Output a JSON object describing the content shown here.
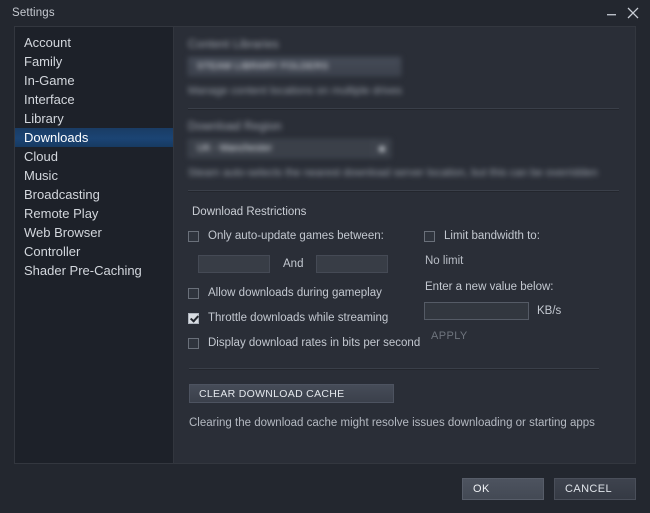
{
  "window": {
    "title": "Settings",
    "minimize_label": "minimize",
    "close_label": "close"
  },
  "sidebar": {
    "items": [
      {
        "label": "Account",
        "selected": false
      },
      {
        "label": "Family",
        "selected": false
      },
      {
        "label": "In-Game",
        "selected": false
      },
      {
        "label": "Interface",
        "selected": false
      },
      {
        "label": "Library",
        "selected": false
      },
      {
        "label": "Downloads",
        "selected": true
      },
      {
        "label": "Cloud",
        "selected": false
      },
      {
        "label": "Music",
        "selected": false
      },
      {
        "label": "Broadcasting",
        "selected": false
      },
      {
        "label": "Remote Play",
        "selected": false
      },
      {
        "label": "Web Browser",
        "selected": false
      },
      {
        "label": "Controller",
        "selected": false
      },
      {
        "label": "Shader Pre-Caching",
        "selected": false
      }
    ]
  },
  "content_libraries": {
    "heading": "Content Libraries",
    "button_label": "STEAM LIBRARY FOLDERS",
    "hint": "Manage content locations on multiple drives"
  },
  "download_region": {
    "heading": "Download Region",
    "selected_value": "UK - Manchester",
    "hint": "Steam auto-selects the nearest download server location, but this can be overridden"
  },
  "download_restrictions": {
    "heading": "Download Restrictions",
    "auto_update": {
      "label": "Only auto-update games between:",
      "checked": false,
      "start_time": "",
      "end_time": "",
      "separator": "And"
    },
    "allow_during_gameplay": {
      "label": "Allow downloads during gameplay",
      "checked": false
    },
    "throttle_while_streaming": {
      "label": "Throttle downloads while streaming",
      "checked": true
    },
    "display_bits": {
      "label": "Display download rates in bits per second",
      "checked": false
    },
    "limit_bandwidth": {
      "label": "Limit bandwidth to:",
      "checked": false,
      "current_status": "No limit",
      "new_value_label": "Enter a new value below:",
      "value": "",
      "units": "KB/s",
      "apply_label": "APPLY"
    }
  },
  "download_cache": {
    "button_label": "CLEAR DOWNLOAD CACHE",
    "hint": "Clearing the download cache might resolve issues downloading or starting apps"
  },
  "footer": {
    "ok_label": "OK",
    "cancel_label": "CANCEL"
  }
}
